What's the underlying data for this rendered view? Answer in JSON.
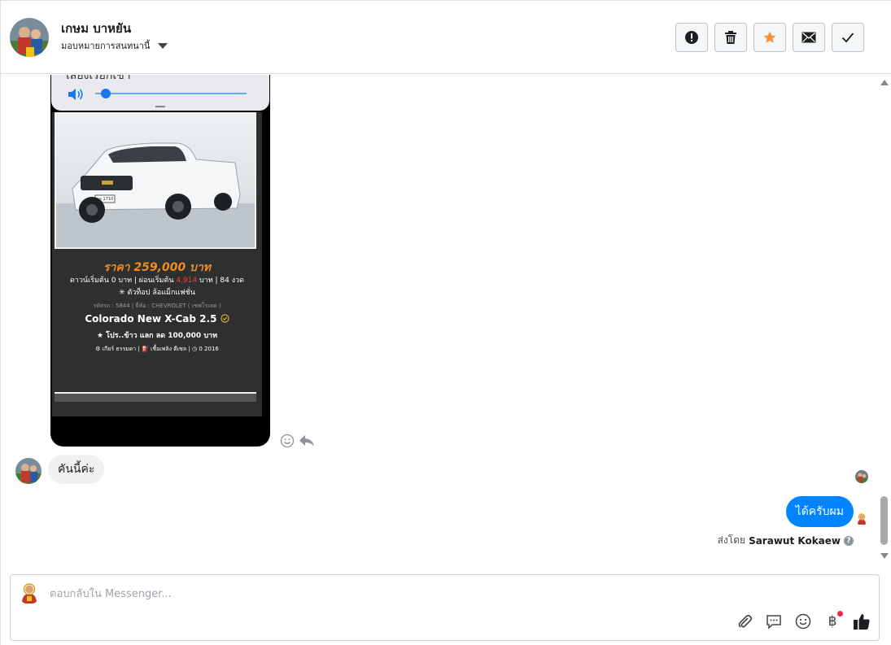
{
  "header": {
    "contact_name": "เกษม บาหยัน",
    "assign_label": "มอบหมายการสนทนานี้",
    "actions": [
      {
        "name": "report-icon"
      },
      {
        "name": "trash-icon"
      },
      {
        "name": "star-icon",
        "color": "#f7923a"
      },
      {
        "name": "envelope-icon"
      },
      {
        "name": "check-icon"
      }
    ]
  },
  "shared_post": {
    "player_title": "เสียงเรียกเข้า",
    "volume_level": 0.05,
    "price": "ราคา 259,000 บาท",
    "finance_pre": "ดาวน์เริ่มต้น 0 บาท | ผ่อนเริ่มต้น ",
    "finance_amount": "4,914",
    "finance_post": " บาท | 84 งวด",
    "highlight": "✳ ตัวท็อป ล้อแม็กแฟชั่น",
    "meta": "รหัสรถ : 5844 | ยี่ห้อ : CHEVROLET ( เชฟโรเลต )",
    "model": "Colorado New X-Cab 2.5",
    "promo": "★ โปร..ข้าว แลก ลด 100,000 บาท",
    "specs": "⚙ เกียร์ ธรรมดา  |  ⛽ เชื้อเพลิง ดีเซล  |  ◷ 0 2016",
    "plate": "ผอ 1710"
  },
  "messages": {
    "incoming": "คันนี้ค่ะ",
    "outgoing": "ได้ครับผม",
    "sent_by_label": "ส่งโดย",
    "sent_by_name": "Sarawut Kokaew"
  },
  "composer": {
    "placeholder": "ตอบกลับใน Messenger...",
    "baht_symbol": "฿"
  },
  "colors": {
    "outgoing_bubble": "#0084ff",
    "incoming_bubble": "#f1f0f0",
    "accent": "#1877f2"
  }
}
